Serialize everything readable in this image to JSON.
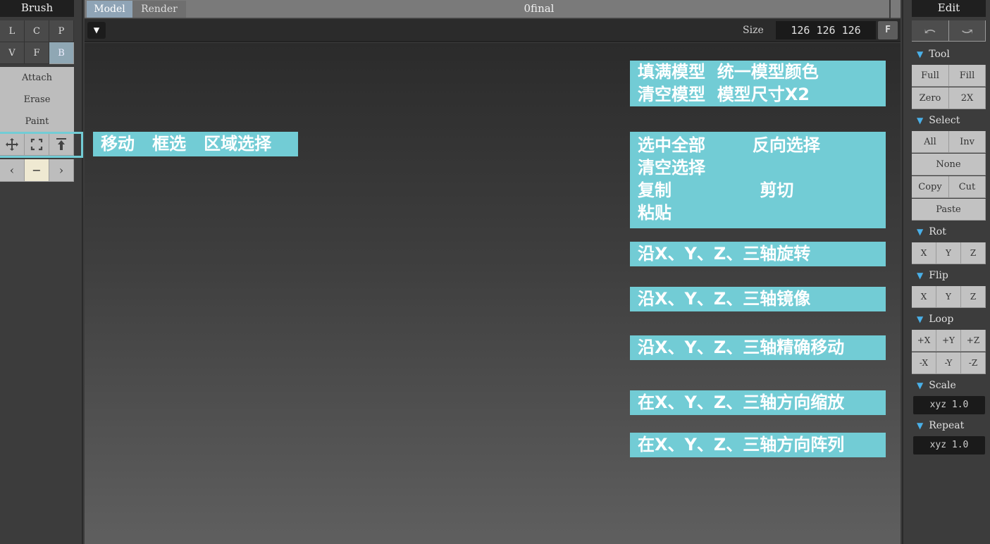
{
  "left_panel": {
    "title": "Brush",
    "mode_row1": [
      "L",
      "C",
      "P"
    ],
    "mode_row2": [
      "V",
      "F",
      "B"
    ],
    "actions": [
      "Attach",
      "Erase",
      "Paint"
    ],
    "tools_icons": [
      "move-icon",
      "box-select-icon",
      "area-select-icon"
    ],
    "nav": {
      "prev": "‹",
      "mid": "−",
      "next": "›"
    }
  },
  "topbar": {
    "tabs": [
      "Model",
      "Render"
    ],
    "document_title": "0final"
  },
  "toolbar2": {
    "menu_symbol": "▼",
    "size_label": "Size",
    "size_value": "126 126 126",
    "f_label": "F"
  },
  "annotations": {
    "tools": "移动   框选   区域选择",
    "tool_section": "填满模型  统一模型颜色\n清空模型  模型尺寸X2",
    "select_section": "选中全部        反向选择\n清空选择\n复制               剪切\n粘贴",
    "rot": "沿X、Y、Z、三轴旋转",
    "flip": "沿X、Y、Z、三轴镜像",
    "loop": "沿X、Y、Z、三轴精确移动",
    "scale": "在X、Y、Z、三轴方向缩放",
    "repeat": "在X、Y、Z、三轴方向阵列"
  },
  "right_panel": {
    "title": "Edit",
    "undo_symbol": "⤺",
    "redo_symbol": "⤻",
    "tool": {
      "header": "Tool",
      "buttons": [
        "Full",
        "Fill",
        "Zero",
        "2X"
      ]
    },
    "select": {
      "header": "Select",
      "buttons": [
        "All",
        "Inv",
        "None",
        "Copy",
        "Cut",
        "Paste"
      ]
    },
    "rot": {
      "header": "Rot",
      "buttons": [
        "X",
        "Y",
        "Z"
      ]
    },
    "flip": {
      "header": "Flip",
      "buttons": [
        "X",
        "Y",
        "Z"
      ]
    },
    "loop": {
      "header": "Loop",
      "buttons": [
        "+X",
        "+Y",
        "+Z",
        "-X",
        "-Y",
        "-Z"
      ]
    },
    "scale": {
      "header": "Scale",
      "value": "xyz 1.0"
    },
    "repeat": {
      "header": "Repeat",
      "value": "xyz 1.0"
    }
  },
  "colors": {
    "annotation": "#72ccd5",
    "selected_button": "#8fa7b4",
    "section_arrow": "#4ab0e8"
  }
}
